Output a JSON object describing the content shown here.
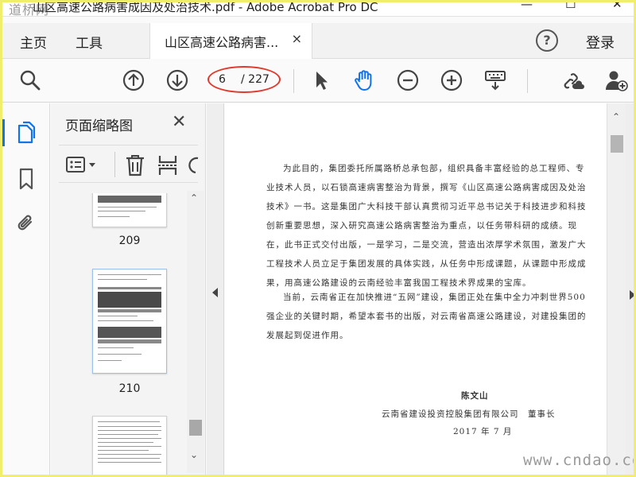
{
  "window": {
    "title": "山区高速公路病害成因及处治技术.pdf - Adobe Acrobat Pro DC",
    "logo_text": "道桥网",
    "minimize_glyph": "—",
    "maximize_glyph": "☐",
    "close_glyph": "✕"
  },
  "tabbar": {
    "home_label": "主页",
    "tools_label": "工具",
    "doc_tab_label": "山区高速公路病害...",
    "doc_tab_close": "×",
    "help_label": "?",
    "login_label": "登录"
  },
  "toolbar": {
    "current_page": "6",
    "total_pages": "/ 227",
    "icons": [
      "search-icon",
      "page-up-icon",
      "page-down-icon",
      "select-arrow-icon",
      "hand-icon",
      "zoom-out-icon",
      "zoom-in-icon",
      "keyboard-icon",
      "share-link-icon",
      "add-user-icon"
    ]
  },
  "rail": {
    "icons": [
      "page-thumbnails-icon",
      "bookmark-icon",
      "attachment-icon"
    ]
  },
  "thumbnails_panel": {
    "title": "页面缩略图",
    "close_glyph": "✕",
    "pages": [
      {
        "label": "209"
      },
      {
        "label": "210"
      }
    ]
  },
  "document": {
    "paragraphs": [
      "为此目的，集团委托所属路桥总承包部，组织具备丰富经验的总工程师、专业技术人员，以石锁高速病害整治为背景，撰写《山区高速公路病害成因及处治技术》一书。这是集团广大科技干部认真贯彻习近平总书记关于科技进步和科技创新重要思想，深入研究高速公路病害整治为重点，以任务带科研的成绩。现在，此书正式交付出版，一是学习，二是交流，营造出浓厚学术氛围，激发广大工程技术人员立足于集团发展的具体实践，从任务中形成课题，从课题中形成成果，用高速公路建设的云南经验丰富我国工程技术界成果的宝库。",
      "当前，云南省正在加快推进“五网”建设，集团正处在集中全力冲刺世界500强企业的关键时期，希望本套书的出版，对云南省高速公路建设，对建投集团的发展起到促进作用。"
    ],
    "signature_name": "陈文山",
    "signature_org": "云南省建设投资控股集团有限公司　董事长",
    "signature_date": "2017 年 7 月"
  },
  "watermark": "www.cndao.com"
}
